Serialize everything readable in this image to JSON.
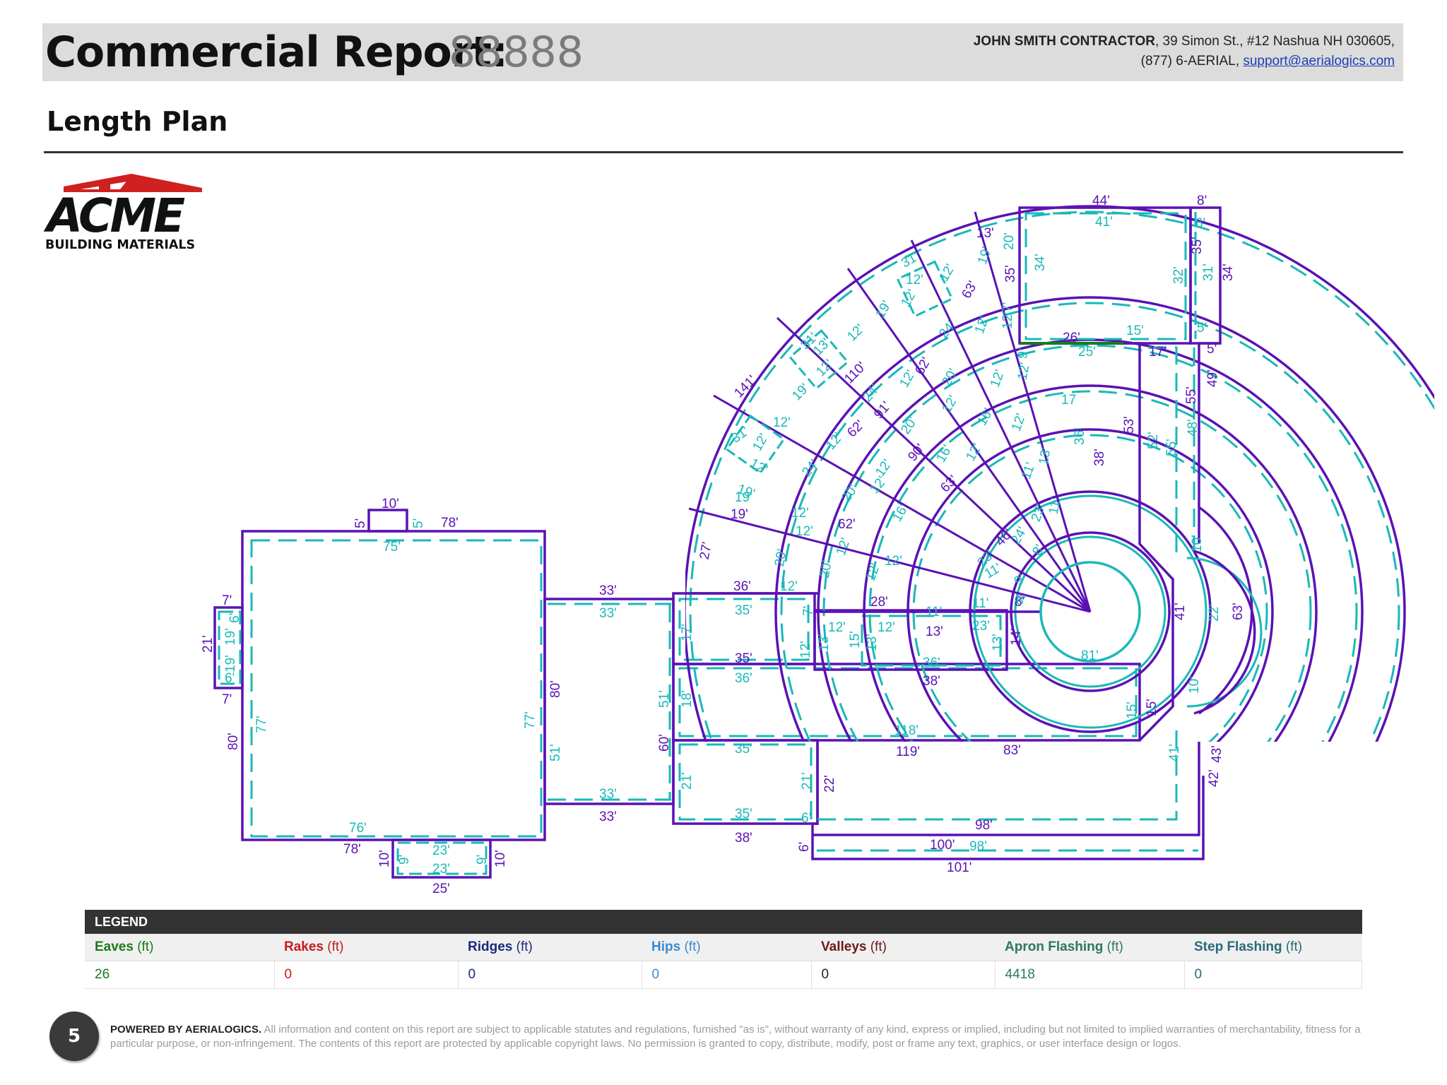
{
  "header": {
    "title": "Commercial Report:",
    "report_number": "88888",
    "contractor_name": "JOHN SMITH CONTRACTOR",
    "contractor_address": ", 39 Simon St., #12 Nashua NH 030605,",
    "phone": "(877) 6-AERIAL,",
    "email": "support@aerialogics.com"
  },
  "section_title": "Length Plan",
  "logo": {
    "name": "ACME",
    "subtitle": "BUILDING MATERIALS",
    "icon": "roof-icon"
  },
  "colors": {
    "outline": "#5a12b4",
    "measure": "#1ab8b8",
    "eave": "#1a7a1a",
    "header_bg": "#dcdcdc",
    "legend_bg": "#333333"
  },
  "plan_labels": {
    "l10a": "10'",
    "l5a": "5'",
    "l5b": "5'",
    "l78a": "78'",
    "l75a": "75'",
    "l7a": "7'",
    "l6a": "6'",
    "l21a": "21'",
    "l19a": "19'",
    "l19b": "19'",
    "l6b": "6'",
    "l7b": "7'",
    "l80a": "80'",
    "l77a": "77'",
    "l77b": "77'",
    "l80b": "80'",
    "l51a": "51'",
    "l76a": "76'",
    "l78b": "78'",
    "l10b": "10'",
    "l9a": "9'",
    "l23a": "23'",
    "l23b": "23'",
    "l9b": "9'",
    "l10c": "10'",
    "l25a": "25'",
    "l33a": "33'",
    "l33b": "33'",
    "l33c": "33'",
    "l33d": "33'",
    "l36a": "36'",
    "l35a": "35'",
    "l12a": "12'",
    "l7c": "7'",
    "l17a": "17'",
    "l12b": "12'",
    "l35b": "35'",
    "l36b": "36'",
    "l51b": "51'",
    "l18a": "18'",
    "l60a": "60'",
    "l35c": "35'",
    "l21b": "21'",
    "l21c": "21'",
    "l22a": "22'",
    "l35d": "35'",
    "l6c": "6'",
    "l38a": "38'",
    "l118": "118'",
    "l119": "119'",
    "l83": "83'",
    "l98a": "98'",
    "l100": "100'",
    "l98b": "98'",
    "l101": "101'",
    "l6d": "6'",
    "l28": "28'",
    "l12c": "12'",
    "l12d": "12'",
    "l13a": "13'",
    "l15a": "15'",
    "l13b": "13'",
    "l36c": "36'",
    "l38b": "38'",
    "l11a": "11'",
    "l13c": "13'",
    "l11b": "11'",
    "l23c": "23'",
    "l13d": "13'",
    "l14": "14'",
    "l8a": "8'",
    "l81": "81'",
    "l15b": "15'",
    "l15c": "15'",
    "l10d": "10'",
    "l10e": "10'",
    "l41a": "41'",
    "l22b": "22'",
    "l63a": "63'",
    "l41b": "41'",
    "l43": "43'",
    "l42": "42'",
    "l44": "44'",
    "l41c": "41'",
    "l8b": "8'",
    "l6e": "6'",
    "l34a": "34'",
    "l35e": "35'",
    "l31a": "31'",
    "l32": "32'",
    "l34b": "34'",
    "l5c": "5'",
    "l26": "26'",
    "l25b": "25'",
    "l15d": "15'",
    "l17b": "17'",
    "l5d": "5'",
    "l49": "49'",
    "l55a": "55'",
    "l48": "48'",
    "l55b": "55'",
    "l53": "53'",
    "l52": "52'",
    "l38c": "38'",
    "l36d": "36'",
    "l17c": "17",
    "l13e": "13'",
    "l20a": "20'",
    "l19c": "19'",
    "l35f": "35'",
    "l31b": "31'",
    "l12e": "12'",
    "l12f": "12'",
    "l12g": "12'",
    "l12h": "12'",
    "l19d": "19'",
    "l63b": "63'",
    "l24a": "24'",
    "l12i": "12'",
    "l7d": "7'",
    "l12j": "12'",
    "l9c": "9'",
    "l12k": "12'",
    "l31c": "31'",
    "l13f": "13'",
    "l12l": "12'",
    "l12m": "12'",
    "l12n": "12'",
    "l19e": "19'",
    "l110": "110'",
    "l24b": "24'",
    "l62a": "62'",
    "l20b": "20'",
    "l12o": "12'",
    "l91": "91'",
    "l62b": "62'",
    "l12p": "12'",
    "l141": "141'",
    "l19f": "19'",
    "l12q": "12'",
    "l31d": "31'",
    "l12r": "12'",
    "l12s": "12'",
    "l12t": "12'",
    "l19g": "19'",
    "l19h": "19'",
    "l24c": "24'",
    "l12u": "12'",
    "l20c": "20'",
    "l90": "90'",
    "l12v": "12'",
    "l16a": "16'",
    "l12w": "12'",
    "l20d": "20'",
    "l12x": "12'",
    "l16b": "16'",
    "l12y": "12'",
    "l63c": "63'",
    "l12z": "12'",
    "l62c": "62'",
    "l12aa": "12'",
    "l16c": "16'",
    "l12ab": "12'",
    "l20e": "20'",
    "l20f": "20'",
    "l27": "27'",
    "l13g": "13'",
    "l11c": "11'",
    "l23d": "23'",
    "l11d": "11'",
    "l24d": "24'",
    "l46": "46'",
    "l8c": "8'",
    "l23e": "23'",
    "l11e": "11'",
    "l9d": "9'",
    "l8d": "8'"
  },
  "legend": {
    "title": "LEGEND",
    "categories": [
      {
        "name": "Eaves",
        "unit": " (ft)",
        "value": "26",
        "color": "#1a7a1a"
      },
      {
        "name": "Rakes",
        "unit": " (ft)",
        "value": "0",
        "color": "#c41c1c"
      },
      {
        "name": "Ridges",
        "unit": " (ft)",
        "value": "0",
        "color": "#1c2a7a"
      },
      {
        "name": "Hips",
        "unit": " (ft)",
        "value": "0",
        "color": "#3a8ad0"
      },
      {
        "name": "Valleys",
        "unit": " (ft)",
        "value": "0",
        "color": "#6a1a1a"
      },
      {
        "name": "Apron Flashing",
        "unit": " (ft)",
        "value": "4418",
        "color": "#2a7a5a"
      },
      {
        "name": "Step Flashing",
        "unit": " (ft)",
        "value": "0",
        "color": "#2a6a7a"
      }
    ]
  },
  "footer": {
    "page_number": "5",
    "powered_by": "POWERED BY AERIALOGICS.",
    "disclaimer": " All information and content on this report are subject to applicable statutes and regulations, furnished \"as is\", without warranty of any kind, express or implied, including but not limited to implied warranties of merchantability, fitness for a particular purpose, or non-infringement. The contents of this report are protected by applicable copyright laws. No permission is granted to copy, distribute, modify, post or frame any text, graphics, or user interface design or logos."
  }
}
